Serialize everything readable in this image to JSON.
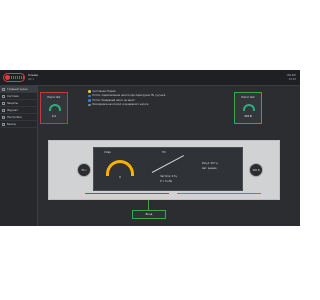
{
  "header": {
    "app_title": "Схема",
    "app_subtitle": "AQ 1",
    "top_right_1": "ONLINE",
    "top_right_2": "09:58"
  },
  "sidebar": {
    "items": [
      {
        "label": "Главный экран",
        "active": true
      },
      {
        "label": "Система",
        "active": false
      },
      {
        "label": "Защиты",
        "active": false
      },
      {
        "label": "Журнал",
        "active": false
      },
      {
        "label": "Настройки",
        "active": false
      },
      {
        "label": "Выход",
        "active": false
      }
    ]
  },
  "cards": {
    "left": {
      "title": "Насос №1",
      "value": "0 A"
    },
    "right": {
      "title": "Насос №2",
      "value": "222 В"
    }
  },
  "legend": {
    "items": [
      {
        "color": "#e6c34a",
        "text": "Состояние: Норма"
      },
      {
        "color": "#3d7bd8",
        "text": "Поток: переключение насоса при перегрузке ПЧ / ручное"
      },
      {
        "color": "#3d7bd8",
        "text": "Поток: Резервный насос не занят"
      },
      {
        "color": "#7f8c8d",
        "text": "Блокировка насоса №1 и резервного насоса"
      }
    ]
  },
  "diagram": {
    "node_left": "55 с",
    "node_right": "220 В",
    "gauge_value": "0",
    "label_tl": "4 бар",
    "label_tr": "ПЧ",
    "label_mid": "Частота: 0 Гц",
    "label_bottom": "P = 0 кПа",
    "label_right_a": "Регул. 50 Гц",
    "label_right_b": "Авт. режим"
  },
  "bottom_box": {
    "label": "Вход"
  },
  "watermark": {
    "text": "Tehno"
  },
  "colors": {
    "accent_red": "#c43a3a",
    "accent_green": "#3aa84a",
    "gauge_amber": "#ffb000"
  }
}
